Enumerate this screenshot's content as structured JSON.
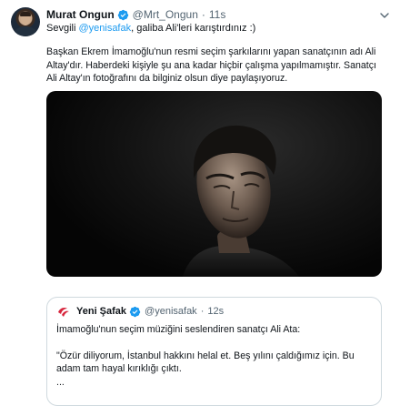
{
  "tweet": {
    "author_name": "Murat Ongun",
    "author_handle": "@Mrt_Ongun",
    "separator": "·",
    "time": "11s",
    "reply_prefix": "Sevgili ",
    "reply_mention": "@yenisafak",
    "reply_suffix": ", galiba Ali'leri karıştırdınız :)",
    "body_lines": [
      "Başkan Ekrem İmamoğlu'nun resmi seçim şarkılarını yapan sanatçının adı Ali",
      "Altay'dır. Haberdeki kişiyle şu ana kadar hiçbir çalışma yapılmamıştır. Sanatçı",
      "Ali Altay'ın fotoğrafını da bilginiz olsun diye paylaşıyoruz."
    ],
    "verified_color": "#1d9bf0"
  },
  "quote": {
    "author_name": "Yeni Şafak",
    "author_handle": "@yenisafak",
    "separator": "·",
    "time": "12s",
    "line1": "İmamoğlu'nun seçim müziğini seslendiren sanatçı Ali Ata:",
    "line2": "\"Özür diliyorum, İstanbul hakkını helal et. Beş yılını çaldığımız için. Bu",
    "line3": "adam tam hayal kırıklığı çıktı.",
    "line4": "..."
  },
  "icons": {
    "verified": "verified-badge-icon",
    "more": "chevron-down-icon",
    "quote_logo": "yeni-safak-logo"
  },
  "colors": {
    "accent": "#1d9bf0",
    "muted": "#536471",
    "border": "#cfd9de",
    "logo_red": "#d7263d"
  }
}
